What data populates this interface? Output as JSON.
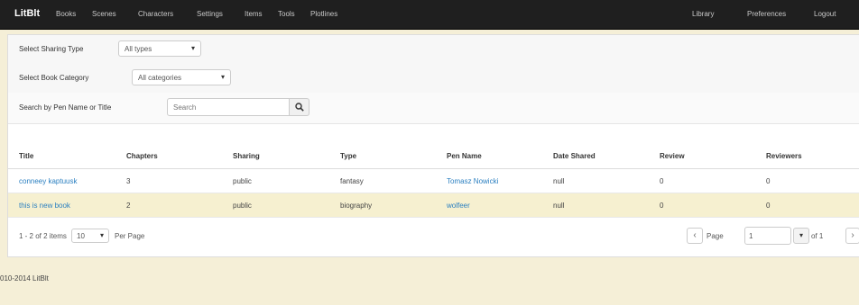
{
  "navbar": {
    "brand": "LitBlt",
    "items": [
      "Books",
      "Scenes",
      "Characters",
      "Settings",
      "Items",
      "Tools",
      "Plotlines"
    ],
    "right_items": [
      "Library",
      "Preferences",
      "Logout"
    ]
  },
  "filters": {
    "sharing_label": "Select Sharing Type",
    "sharing_value": "All types",
    "category_label": "Select Book Category",
    "category_value": "All categories",
    "search_label": "Search by Pen Name or Title",
    "search_placeholder": "Search"
  },
  "table": {
    "headers": [
      "Title",
      "Chapters",
      "Sharing",
      "Type",
      "Pen Name",
      "Date Shared",
      "Review",
      "Reviewers"
    ],
    "rows": [
      [
        "conneey kaptuusk",
        "3",
        "public",
        "fantasy",
        "Tomasz Nowicki",
        "null",
        "0",
        "0"
      ],
      [
        "this is new book",
        "2",
        "public",
        "biography",
        "wolfeer",
        "null",
        "0",
        "0"
      ]
    ]
  },
  "pager": {
    "summary": "1 - 2 of 2 items",
    "page_size": "10",
    "per_page_label": "Per Page",
    "page_label": "Page",
    "page_value": "1",
    "of_label": "of 1"
  },
  "footer": {
    "text": "010-2014 LitBlt"
  }
}
